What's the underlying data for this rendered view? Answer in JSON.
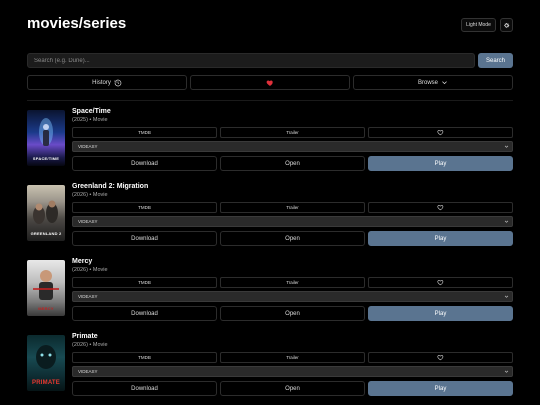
{
  "app": {
    "title": "movies/series"
  },
  "header": {
    "theme_toggle_label": "Light Mode"
  },
  "search": {
    "placeholder": "Search (e.g. Dune)...",
    "button_label": "Search"
  },
  "nav": {
    "history_label": "History",
    "browse_label": "Browse"
  },
  "colors": {
    "accent": "#5a7490",
    "heart": "#e0303a"
  },
  "cards": [
    {
      "title": "Space/Time",
      "meta": "(2025) • Movie",
      "poster_caption": "SPACE/TIME",
      "source": "VIDEASY",
      "tmdb_label": "TMDB",
      "trailer_label": "Trailer",
      "download_label": "Download",
      "open_label": "Open",
      "play_label": "Play"
    },
    {
      "title": "Greenland 2: Migration",
      "meta": "(2026) • Movie",
      "poster_caption": "GREENLAND 2",
      "source": "VIDEASY",
      "tmdb_label": "TMDB",
      "trailer_label": "Trailer",
      "download_label": "Download",
      "open_label": "Open",
      "play_label": "Play"
    },
    {
      "title": "Mercy",
      "meta": "(2026) • Movie",
      "poster_caption": "MERCY",
      "source": "VIDEASY",
      "tmdb_label": "TMDB",
      "trailer_label": "Trailer",
      "download_label": "Download",
      "open_label": "Open",
      "play_label": "Play"
    },
    {
      "title": "Primate",
      "meta": "(2026) • Movie",
      "poster_caption": "PRIMATE",
      "source": "VIDEASY",
      "tmdb_label": "TMDB",
      "trailer_label": "Trailer",
      "download_label": "Download",
      "open_label": "Open",
      "play_label": "Play"
    }
  ]
}
